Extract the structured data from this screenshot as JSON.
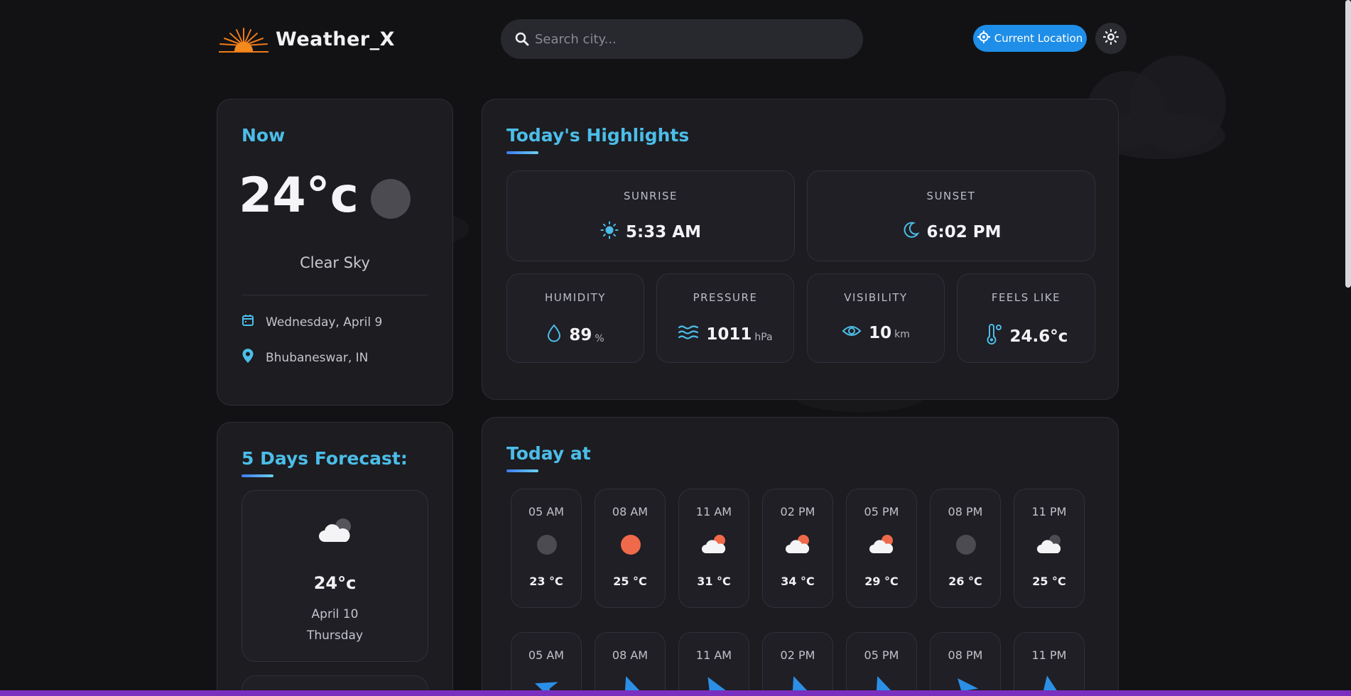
{
  "app": {
    "brand": "Weather_X"
  },
  "search": {
    "placeholder": "Search city..."
  },
  "header": {
    "current_location_label": "Current Location"
  },
  "now": {
    "title": "Now",
    "temperature": "24°c",
    "condition": "Clear Sky",
    "date": "Wednesday, April 9",
    "location": "Bhubaneswar, IN"
  },
  "highlights": {
    "title": "Today's Highlights",
    "sunrise": {
      "label": "SUNRISE",
      "value": "5:33 AM"
    },
    "sunset": {
      "label": "SUNSET",
      "value": "6:02 PM"
    },
    "humidity": {
      "label": "HUMIDITY",
      "value": "89",
      "unit": "%"
    },
    "pressure": {
      "label": "PRESSURE",
      "value": "1011",
      "unit": "hPa"
    },
    "visibility": {
      "label": "VISIBILITY",
      "value": "10",
      "unit": "km"
    },
    "feels_like": {
      "label": "FEELS LIKE",
      "value": "24.6°c"
    }
  },
  "forecast": {
    "title": "5 Days Forecast:",
    "items": [
      {
        "temp": "24°c",
        "date": "April 10",
        "day": "Thursday"
      }
    ]
  },
  "today_at": {
    "title": "Today at",
    "hours": [
      {
        "time": "05 AM",
        "temp": "23 °C",
        "icon": "moon-icon"
      },
      {
        "time": "08 AM",
        "temp": "25 °C",
        "icon": "sun-icon"
      },
      {
        "time": "11 AM",
        "temp": "31 °C",
        "icon": "cloud-sun-icon"
      },
      {
        "time": "02 PM",
        "temp": "34 °C",
        "icon": "cloud-sun-icon"
      },
      {
        "time": "05 PM",
        "temp": "29 °C",
        "icon": "cloud-sun-icon"
      },
      {
        "time": "08 PM",
        "temp": "26 °C",
        "icon": "moon-icon"
      },
      {
        "time": "11 PM",
        "temp": "25 °C",
        "icon": "cloud-moon-icon"
      }
    ],
    "wind_hours": [
      "05 AM",
      "08 AM",
      "11 AM",
      "02 PM",
      "05 PM",
      "08 PM",
      "11 PM"
    ]
  },
  "colors": {
    "accent": "#4cbde8",
    "button": "#1e8ee8",
    "sun": "#ef6a4a",
    "background": "#121214"
  }
}
